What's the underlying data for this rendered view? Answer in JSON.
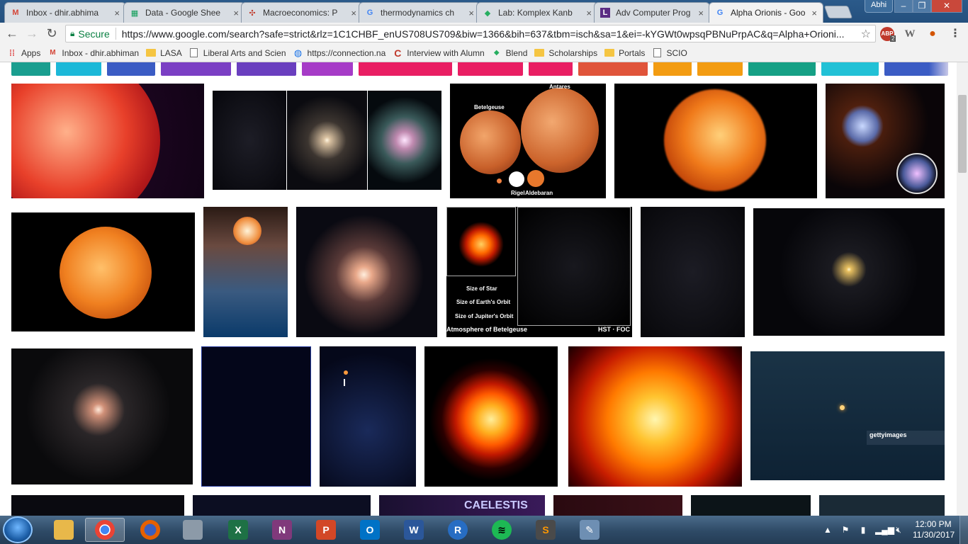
{
  "browser": {
    "tabs": [
      {
        "title": "Inbox - dhir.abhima",
        "icon": "gmail-icon",
        "color": "#d44638",
        "glyph": "M"
      },
      {
        "title": "Data - Google Shee",
        "icon": "sheets-icon",
        "color": "#0f9d58",
        "glyph": "▦"
      },
      {
        "title": "Macroeconomics: P",
        "icon": "pinwheel-icon",
        "color": "#c0392b",
        "glyph": "✣"
      },
      {
        "title": "thermodynamics ch",
        "icon": "google-icon",
        "color": "#4285f4",
        "glyph": "G"
      },
      {
        "title": "Lab: Komplex Kanb",
        "icon": "blend-icon",
        "color": "#27ae60",
        "glyph": "◆"
      },
      {
        "title": "Adv Computer Prog",
        "icon": "lasa-icon",
        "color": "#5b2c83",
        "glyph": "L"
      },
      {
        "title": "Alpha Orionis - Goo",
        "icon": "google-icon",
        "color": "#4285f4",
        "glyph": "G",
        "active": true
      }
    ],
    "user": "Abhi",
    "window_controls": {
      "minimize": "‒",
      "maximize": "❐",
      "close": "✕"
    },
    "nav": {
      "back": "←",
      "forward": "→",
      "reload": "↻"
    },
    "address": {
      "secure_label": "Secure",
      "url": "https://www.google.com/search?safe=strict&rlz=1C1CHBF_enUS708US709&biw=1366&bih=637&tbm=isch&sa=1&ei=-kYGWt0wpsqPBNuPrpAC&q=Alpha+Orioni..."
    },
    "extensions": [
      {
        "name": "adblock-icon",
        "label": "ABP",
        "badge": "2",
        "color": "#c0392b"
      },
      {
        "name": "wikipedia-icon",
        "label": "W",
        "color": "#666666"
      },
      {
        "name": "cookie-icon",
        "label": "●",
        "color": "#d35400"
      },
      {
        "name": "menu-icon",
        "label": "⋮",
        "color": "#555555"
      }
    ],
    "bookmarks": [
      {
        "label": "Apps",
        "kind": "apps"
      },
      {
        "label": "Inbox - dhir.abhiman",
        "kind": "gmail"
      },
      {
        "label": "LASA",
        "kind": "folder"
      },
      {
        "label": "Liberal Arts and Scien",
        "kind": "doc"
      },
      {
        "label": "https://connection.na",
        "kind": "globe"
      },
      {
        "label": "Interview with Alumn",
        "kind": "c"
      },
      {
        "label": "Blend",
        "kind": "blend"
      },
      {
        "label": "Scholarships",
        "kind": "folder"
      },
      {
        "label": "Portals",
        "kind": "folder"
      },
      {
        "label": "SCIO",
        "kind": "doc"
      }
    ]
  },
  "search": {
    "filter_chip_colors": [
      "#1a9e8f",
      "#1cb8d8",
      "#3b5cc4",
      "#7b3fc4",
      "#6a3fbf",
      "#a63bc7",
      "#e91e63",
      "#e91e63",
      "#e91e63",
      "#e0543a",
      "#f39c12",
      "#f39c12",
      "#16a085",
      "#22c1d6",
      "#3b5cc4"
    ],
    "image_captions": {
      "betelgeuse": "Betelgeuse",
      "antares": "Antares",
      "rigel": "Rigel",
      "aldebaran": "Aldebaran",
      "size_star": "Size of Star",
      "size_earth": "Size of Earth's Orbit",
      "size_jupiter": "Size of Jupiter's Orbit",
      "atmosphere": "Atmosphere of Betelgeuse",
      "hst": "HST · FOC",
      "getty": "gettyimages",
      "caelestis": "CAELESTIS"
    }
  },
  "taskbar": {
    "apps": [
      {
        "name": "file-explorer-icon",
        "label": "",
        "color": "#e8b84a"
      },
      {
        "name": "chrome-icon",
        "label": "",
        "color": "#ea4335",
        "active": true
      },
      {
        "name": "firefox-icon",
        "label": "",
        "color": "#e66000"
      },
      {
        "name": "calculator-icon",
        "label": "",
        "color": "#8c9aa8"
      },
      {
        "name": "excel-icon",
        "label": "X",
        "color": "#1e7145"
      },
      {
        "name": "onenote-icon",
        "label": "N",
        "color": "#80397b"
      },
      {
        "name": "powerpoint-icon",
        "label": "P",
        "color": "#d24726"
      },
      {
        "name": "outlook-icon",
        "label": "O",
        "color": "#0072c6"
      },
      {
        "name": "word-icon",
        "label": "W",
        "color": "#2b579a"
      },
      {
        "name": "r-icon",
        "label": "R",
        "color": "#276dc3"
      },
      {
        "name": "spotify-icon",
        "label": "≋",
        "color": "#1db954"
      },
      {
        "name": "sublime-icon",
        "label": "S",
        "color": "#4a4a4a"
      },
      {
        "name": "paint-icon",
        "label": "✎",
        "color": "#6e8fb3"
      }
    ],
    "clock_time": "12:00 PM",
    "clock_date": "11/30/2017"
  }
}
